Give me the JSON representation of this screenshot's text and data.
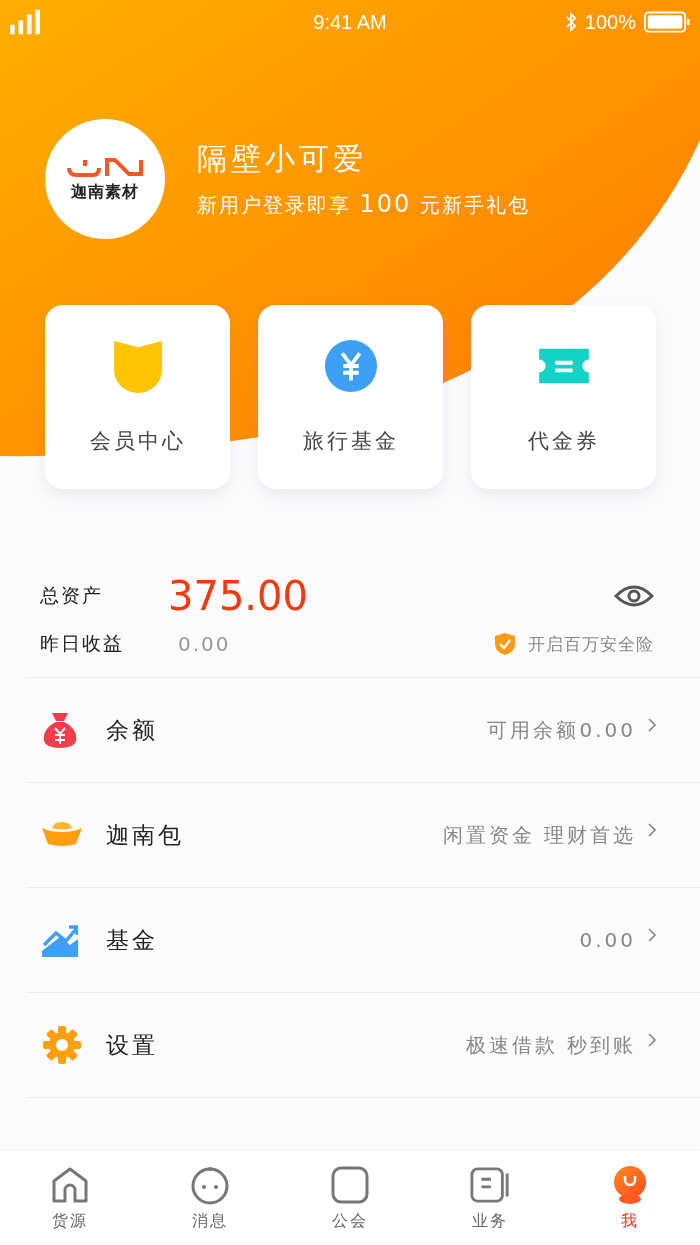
{
  "status_bar": {
    "time": "9:41 AM",
    "battery": "100%"
  },
  "profile": {
    "logo_text": "迦南素材",
    "name": "隔壁小可爱",
    "promo_before": "新用户登录即享",
    "promo_amount": "100",
    "promo_after": "元新手礼包"
  },
  "shortcuts": [
    {
      "kind": "member",
      "label": "会员中心"
    },
    {
      "kind": "fund",
      "label": "旅行基金"
    },
    {
      "kind": "coupon",
      "label": "代金券"
    }
  ],
  "assets": {
    "total_label": "总资产",
    "total_value": "375.00",
    "yesterday_label": "昨日收益",
    "yesterday_value": "0.00",
    "insurance": "开启百万安全险"
  },
  "menu": [
    {
      "kind": "balance",
      "label": "余额",
      "detail": "可用余额0.00"
    },
    {
      "kind": "ingot",
      "label": "迦南包",
      "detail": "闲置资金 理财首选"
    },
    {
      "kind": "chart",
      "label": "基金",
      "detail": "0.00"
    },
    {
      "kind": "gear",
      "label": "设置",
      "detail": "极速借款 秒到账"
    }
  ],
  "tab_bar": [
    {
      "kind": "home",
      "label": "货源",
      "selected": false
    },
    {
      "kind": "face",
      "label": "消息",
      "selected": false
    },
    {
      "kind": "square",
      "label": "公会",
      "selected": false
    },
    {
      "kind": "doc",
      "label": "业务",
      "selected": false
    },
    {
      "kind": "me",
      "label": "我",
      "selected": true
    }
  ]
}
